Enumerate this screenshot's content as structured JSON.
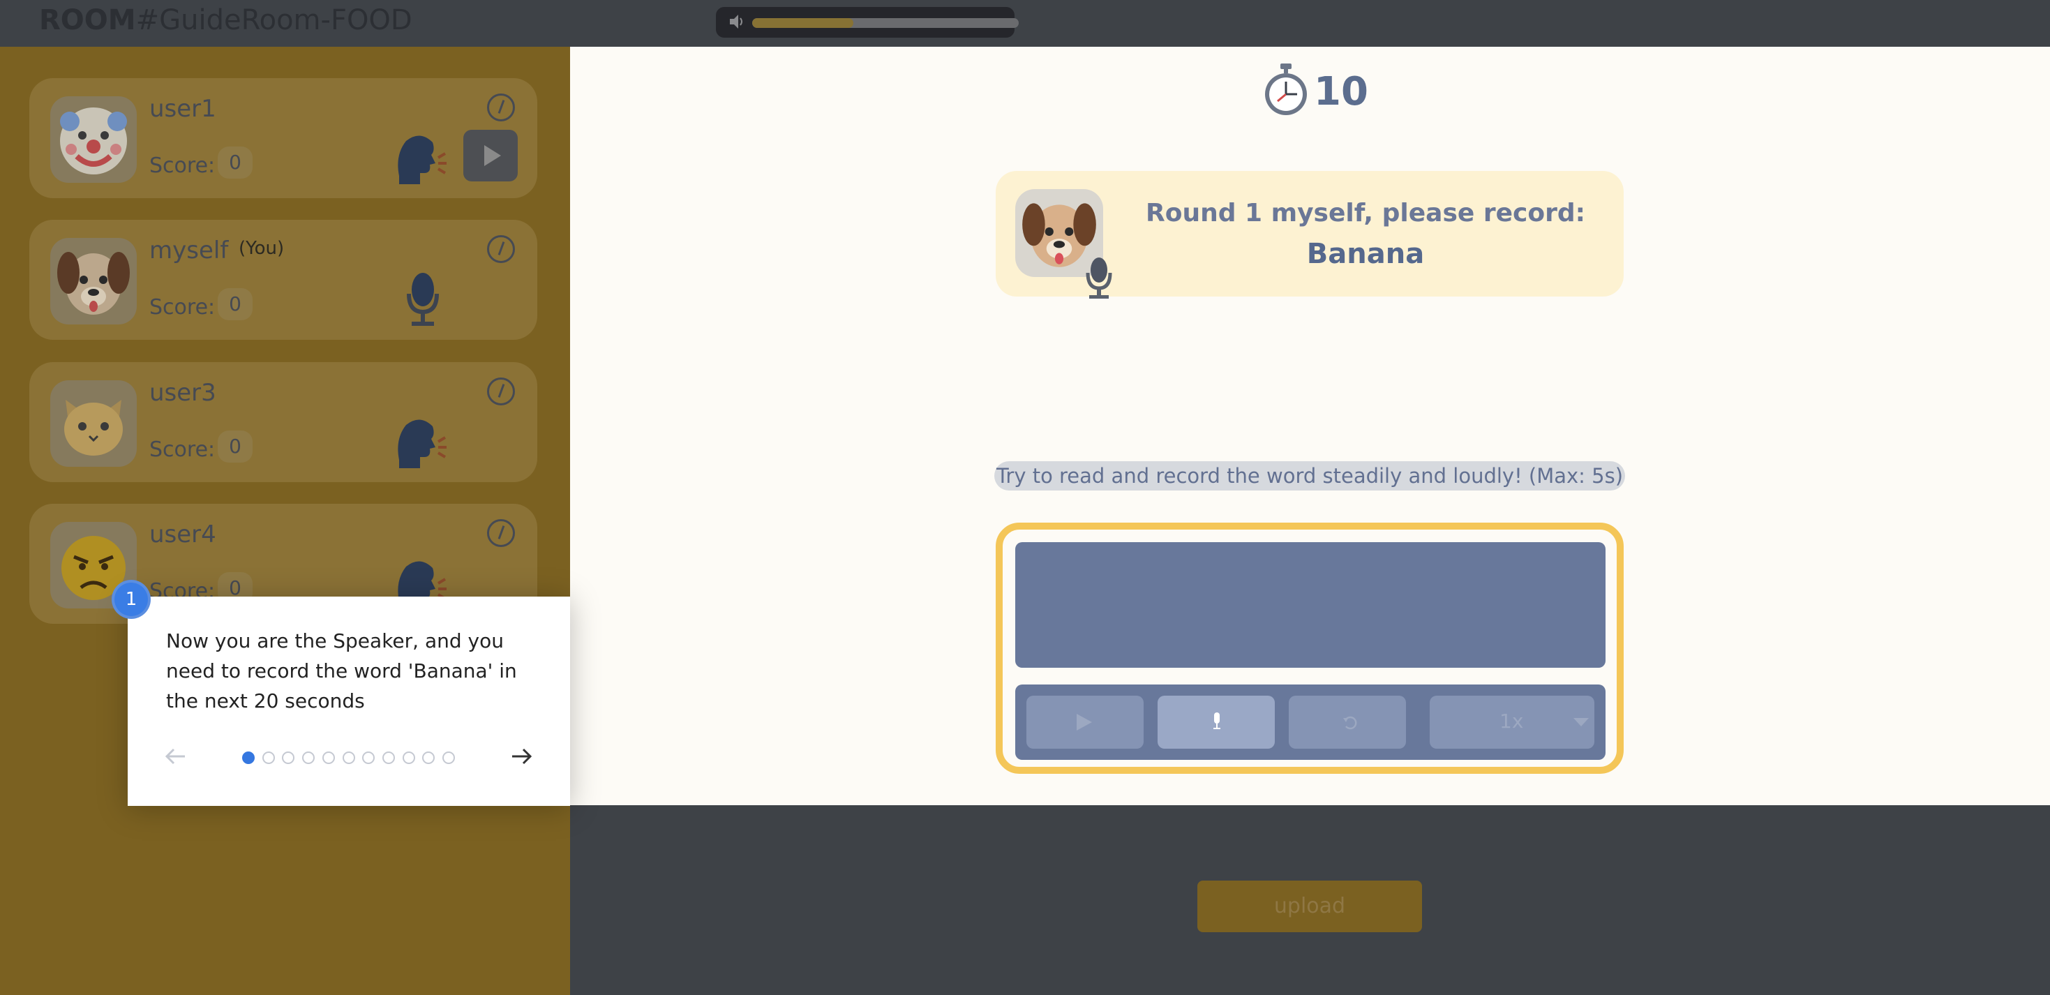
{
  "header": {
    "room_prefix": "ROOM",
    "room_name": "#GuideRoom-FOOD",
    "volume_level": 0.38
  },
  "players": [
    {
      "name": "user1",
      "you_label": "",
      "score_label": "Score:",
      "score": "0",
      "avatar": "clown-face",
      "status": "speaking-head-icon",
      "has_play": true
    },
    {
      "name": "myself",
      "you_label": "(You)",
      "score_label": "Score:",
      "score": "0",
      "avatar": "dog-face",
      "status": "microphone-icon",
      "has_play": false
    },
    {
      "name": "user3",
      "you_label": "",
      "score_label": "Score:",
      "score": "0",
      "avatar": "cat-face",
      "status": "speaking-head-icon",
      "has_play": false
    },
    {
      "name": "user4",
      "you_label": "",
      "score_label": "Score:",
      "score": "0",
      "avatar": "angry-face",
      "status": "speaking-head-icon",
      "has_play": false
    }
  ],
  "timer": {
    "value": "10",
    "icon": "stopwatch-icon"
  },
  "prompt": {
    "line1": "Round 1 myself, please record:",
    "word": "Banana",
    "avatar": "dog-face",
    "badge_icon": "microphone-icon"
  },
  "tip": "Try to read and record the word steadily and loudly! (Max: 5s)",
  "recorder": {
    "speed": "1x",
    "buttons": [
      "play-icon",
      "record-icon",
      "undo-icon"
    ]
  },
  "upload_label": "upload",
  "tour": {
    "step": "1",
    "text": "Now you are the Speaker, and you need to record the word 'Banana' in the next 20 seconds",
    "total_steps": 11,
    "current_step": 1
  },
  "colors": {
    "accent": "#f4c658",
    "primary": "#68789b",
    "overlay": "#3e4247",
    "sidebar": "#7b6121",
    "tour_blue": "#3577e0"
  }
}
